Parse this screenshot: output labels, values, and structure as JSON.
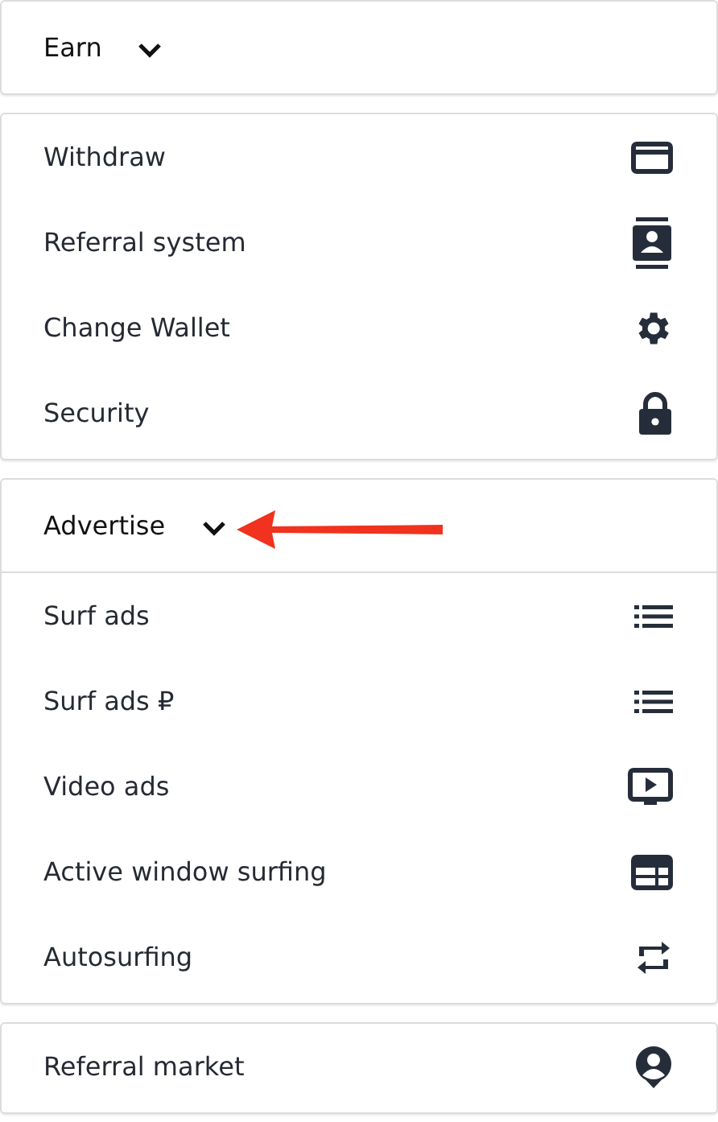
{
  "sections": [
    {
      "header": {
        "label": "Earn"
      }
    },
    {
      "items": [
        {
          "label": "Withdraw",
          "kind": "card"
        },
        {
          "label": "Referral system",
          "kind": "contact"
        },
        {
          "label": "Change Wallet",
          "kind": "gear"
        },
        {
          "label": "Security",
          "kind": "lock"
        }
      ]
    },
    {
      "header": {
        "label": "Advertise",
        "pointer": true
      },
      "items": [
        {
          "label": "Surf ads",
          "kind": "list"
        },
        {
          "label": "Surf ads ₽",
          "kind": "list"
        },
        {
          "label": "Video ads",
          "kind": "video"
        },
        {
          "label": "Active window surfing",
          "kind": "window"
        },
        {
          "label": "Autosurfing",
          "kind": "repeat"
        }
      ]
    },
    {
      "items": [
        {
          "label": "Referral market",
          "kind": "user"
        }
      ]
    }
  ]
}
